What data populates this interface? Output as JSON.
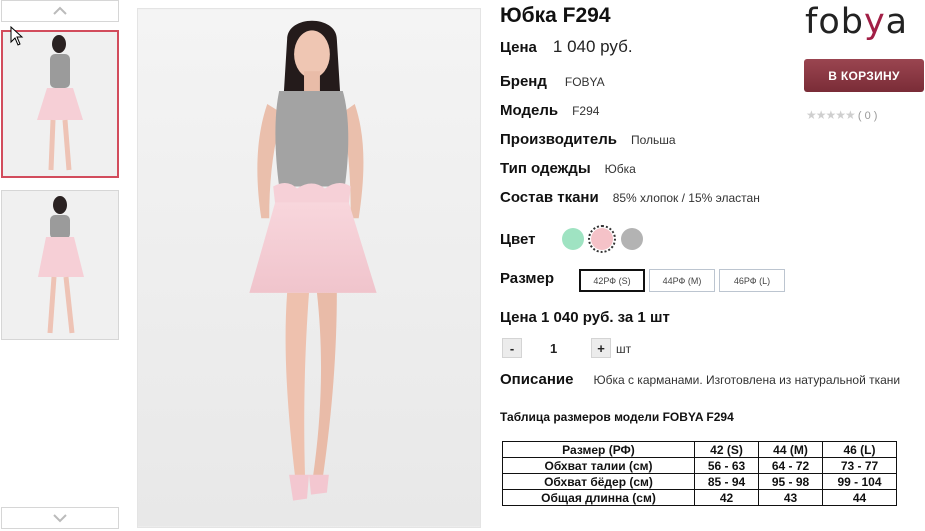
{
  "product": {
    "title": "Юбка F294"
  },
  "specs": {
    "price_label": "Цена",
    "price_value": "1 040 руб.",
    "brand_label": "Бренд",
    "brand_value": "FOBYA",
    "model_label": "Модель",
    "model_value": "F294",
    "maker_label": "Производитель",
    "maker_value": "Польша",
    "type_label": "Тип одежды",
    "type_value": "Юбка",
    "fabric_label": "Состав ткани",
    "fabric_value": "85% хлопок / 15% эластан"
  },
  "color": {
    "label": "Цвет",
    "swatches": [
      {
        "name": "mint",
        "hex": "#9fe3c2"
      },
      {
        "name": "pink",
        "hex": "#f5c2c8",
        "selected": true
      },
      {
        "name": "grey",
        "hex": "#b3b3b3"
      }
    ]
  },
  "size": {
    "label": "Размер",
    "options": [
      "42РФ (S)",
      "44РФ (M)",
      "46РФ (L)"
    ],
    "selected": "42РФ (S)"
  },
  "price_per": {
    "text": "Цена 1 040 руб. за 1 шт"
  },
  "quantity": {
    "minus": "-",
    "value": "1",
    "plus": "+",
    "unit": "шт"
  },
  "description": {
    "label": "Описание",
    "text": "Юбка с карманами. Изготовлена из натуральной ткани"
  },
  "size_table": {
    "title": "Таблица размеров модели FOBYA F294",
    "header": [
      "Размер (РФ)",
      "42 (S)",
      "44 (M)",
      "46 (L)"
    ],
    "rows": [
      [
        "Обхват талии (см)",
        "56 - 63",
        "64 - 72",
        "73 - 77"
      ],
      [
        "Обхват бёдер (см)",
        "85 - 94",
        "95 - 98",
        "99 - 104"
      ],
      [
        "Общая длинна (см)",
        "42",
        "43",
        "44"
      ]
    ]
  },
  "brand_logo": {
    "part1": "fob",
    "part2": "y",
    "part3": "a"
  },
  "cart": {
    "label": "В КОРЗИНУ"
  },
  "rating": {
    "stars": "★★★★★",
    "count": "( 0 )"
  },
  "colors": {
    "accent": "#8a3641",
    "thumb_active_border": "#d24c5c",
    "logo_y": "#a21f46"
  },
  "icons": {
    "thumb_up": "chevron-up-icon",
    "thumb_down": "chevron-down-icon"
  }
}
